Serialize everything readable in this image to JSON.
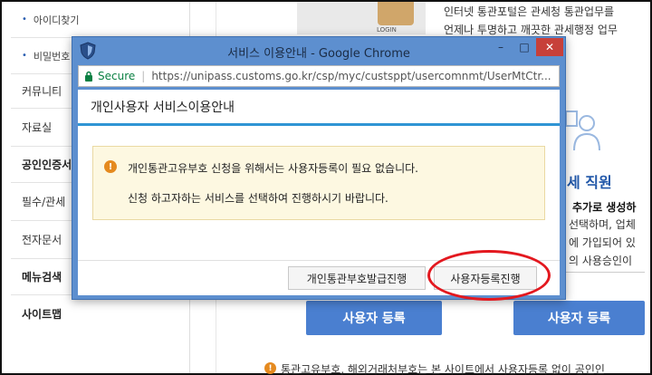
{
  "background": {
    "sidebar": [
      {
        "label": "아이디찾기",
        "sub": true
      },
      {
        "label": "비밀번호",
        "sub": true
      },
      {
        "label": "커뮤니티",
        "sub": false
      },
      {
        "label": "자료실",
        "sub": false
      },
      {
        "label": "공인인증서",
        "sub": false
      },
      {
        "label": "필수/관세",
        "sub": false
      },
      {
        "label": "전자문서",
        "sub": false
      },
      {
        "label": "메뉴검색",
        "sub": false
      },
      {
        "label": "사이트맵",
        "sub": false
      }
    ],
    "intro_line1": "인터넷 통관포털은 관세청 통관업무를",
    "intro_line2": "언제나 투명하고 깨끗한 관세행정 업무",
    "login_image_label": "LOGIN",
    "staff_title": "세 직원",
    "staff_lines": [
      "추가로 생성하",
      "선택하며, 업체",
      "에 가입되어 있",
      "의 사용승인이"
    ],
    "register_button_left": "사용자 등록",
    "register_button_right": "사용자 등록",
    "bottom_notice": "통관고유부호, 해외거래처부호는 본 사이트에서 사용자등록 없이 공인인"
  },
  "popup": {
    "window_title": "서비스 이용안내 - Google Chrome",
    "secure_label": "Secure",
    "url": "https://unipass.customs.go.kr/csp/myc/custsppt/usercomnmt/UserMtCtr...",
    "header": "개인사용자 서비스이용안내",
    "message_line1": "개인통관고유부호 신청을 위해서는 사용자등록이 필요 없습니다.",
    "message_line2": "신청 하고자하는 서비스를 선택하여 진행하시기 바랍니다.",
    "button_issue": "개인통관부호발급진행",
    "button_register": "사용자등록진행"
  },
  "colors": {
    "accent_blue": "#2f95d4",
    "window_frame": "#5d8fcf",
    "close_red": "#c7403a",
    "annotation_red": "#e3181f",
    "notice_bg": "#fdf8e1",
    "warn_orange": "#e58a1f"
  }
}
